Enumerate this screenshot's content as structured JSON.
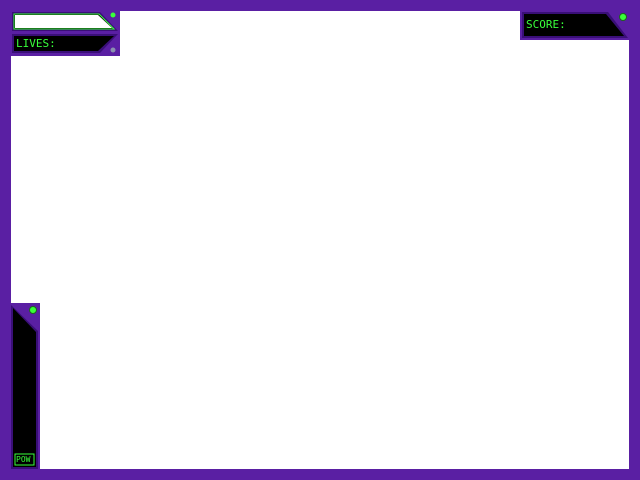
{
  "hud": {
    "lives_label": "LIVES:",
    "score_label": "SCORE:",
    "power_label": "POW",
    "health_level": 1.0
  },
  "colors": {
    "frame": "#5a1fa3",
    "frame_dark": "#3a0f78",
    "panel_bg": "#000000",
    "accent": "#39ff3a",
    "playfield": "#ffffff",
    "rivet": "#8a90b0"
  },
  "icons": {
    "rivet": "round-rivet-icon",
    "gem": "green-gem-icon"
  }
}
